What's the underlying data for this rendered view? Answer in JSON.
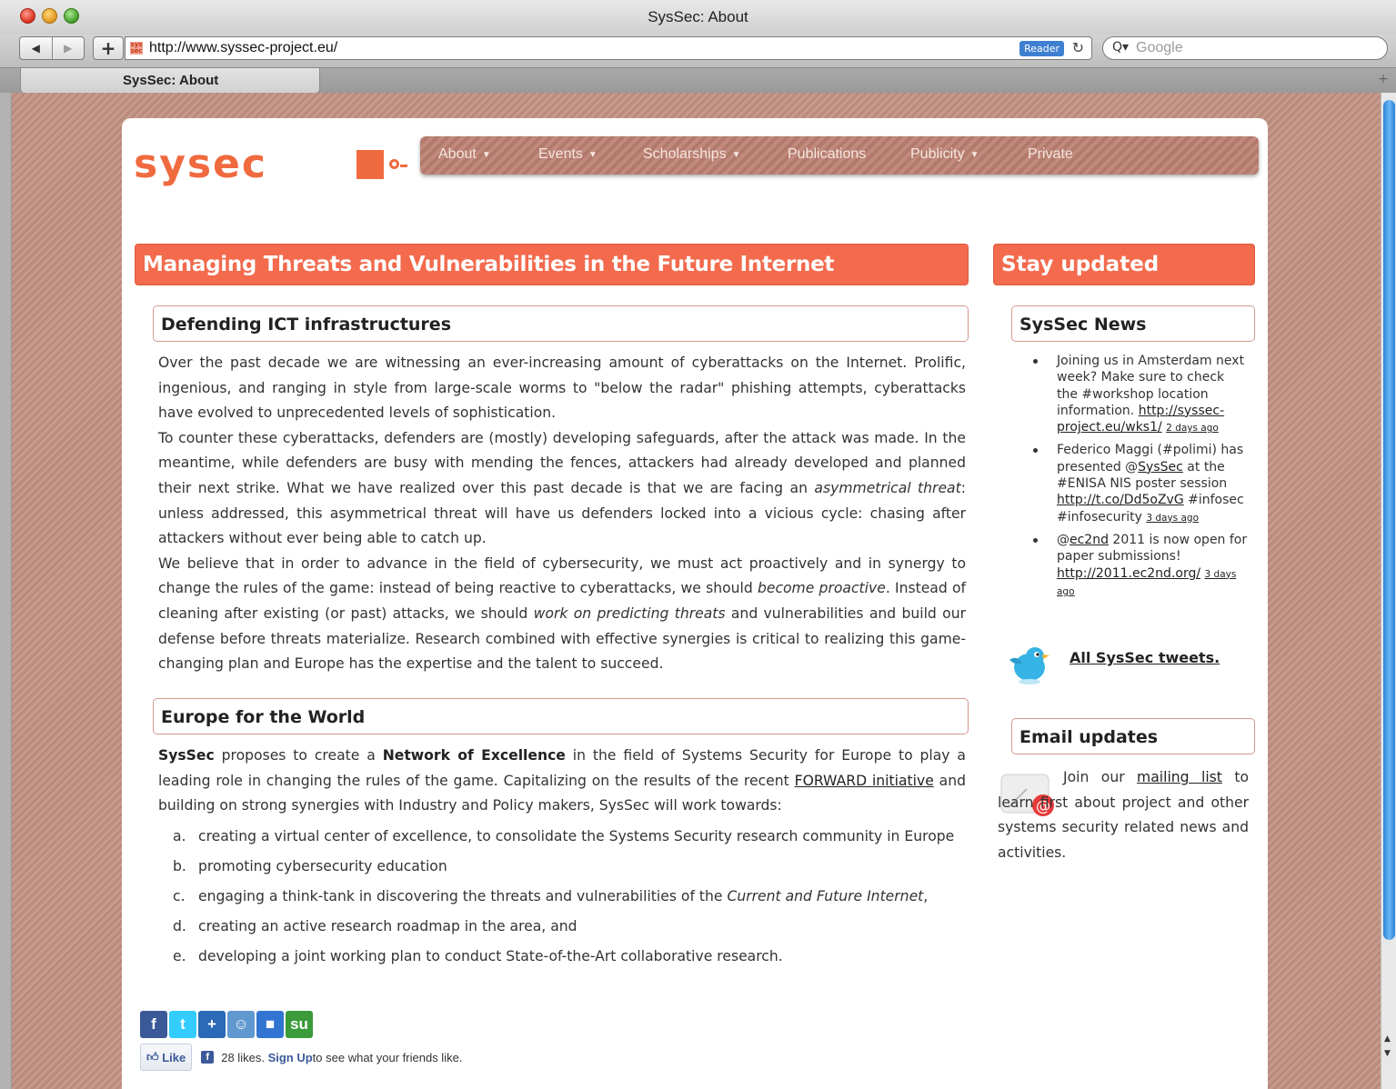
{
  "window": {
    "title": "SysSec: About"
  },
  "toolbar": {
    "back": "◀",
    "forward": "▶",
    "add": "+",
    "url": "http://www.syssec-project.eu/",
    "favicon_text": "sys sec",
    "reader": "Reader",
    "reload": "↻",
    "search_icon": "Q▾",
    "search_placeholder": "Google"
  },
  "tabs": [
    {
      "label": "SysSec: About"
    }
  ],
  "logo": {
    "text": "sysec"
  },
  "nav": [
    {
      "label": "About",
      "caret": "▼"
    },
    {
      "label": "Events",
      "caret": "▼"
    },
    {
      "label": "Scholarships",
      "caret": "▼"
    },
    {
      "label": "Publications",
      "caret": ""
    },
    {
      "label": "Publicity",
      "caret": "▼"
    },
    {
      "label": "Private",
      "caret": ""
    }
  ],
  "main": {
    "title": "Managing Threats and Vulnerabilities in the Future Internet",
    "sections": [
      {
        "heading": "Defending ICT infrastructures",
        "paragraphs": [
          [
            "Over the past decade we are witnessing an ever-increasing amount of cyberattacks on the Internet. Prolific, ingenious, and ranging in style from large-scale worms to \"below the radar\" phishing attempts, cyberattacks have evolved to unprecedented levels of sophistication."
          ],
          [
            "To counter these cyberattacks, defenders are (mostly) developing safeguards, after the attack was made. In the meantime, while defenders are busy with mending the fences, attackers had already developed and planned their next strike. What we have realized over this past decade is that we are facing an ",
            "asymmetrical threat",
            ": unless addressed, this asymmetrical threat will have us defenders locked into a vicious cycle: chasing after attackers without ever being able to catch up."
          ],
          [
            "We believe that in order to advance in the field of cybersecurity, we must act proactively and in synergy to change the rules of the game: instead of being reactive to cyberattacks, we should ",
            "become proactive",
            ". Instead of cleaning after existing (or past) attacks, we should ",
            "work on predicting threats",
            " and vulnerabilities and build our defense before threats materialize. Research combined with effective synergies is critical to realizing this game-changing plan and Europe has the expertise and the talent to succeed."
          ]
        ]
      },
      {
        "heading": "Europe for the World",
        "intro": {
          "b1": "SysSec",
          "t1": " proposes to create a ",
          "b2": "Network of Excellence",
          "t2": " in the field of Systems Security for Europe to play a leading role in changing the rules of the game. Capitalizing on the results of the recent ",
          "link": "FORWARD initiative",
          "t3": " and building on strong synergies with Industry and Policy makers, SysSec will work towards:"
        },
        "list": [
          {
            "marker": "a.",
            "text": "creating a virtual center of excellence, to consolidate the Systems Security research community in Europe"
          },
          {
            "marker": "b.",
            "text": "promoting cybersecurity education"
          },
          {
            "marker": "c.",
            "pre": "engaging a think-tank in discovering the threats and vulnerabilities of the ",
            "em": "Current and Future Internet",
            "post": ","
          },
          {
            "marker": "d.",
            "text": "creating an active research roadmap in the area, and"
          },
          {
            "marker": "e.",
            "text": "developing a joint working plan to conduct State-of-the-Art collaborative research."
          }
        ]
      }
    ]
  },
  "sidebar": {
    "title": "Stay updated",
    "news_heading": "SysSec News",
    "news": [
      {
        "t1": "Joining us in Amsterdam next week? Make sure to check the #workshop location information. ",
        "link": "http://syssec-project.eu/wks1/",
        "ago": "2 days ago"
      },
      {
        "t1": "Federico Maggi (#polimi) has presented @",
        "link1": "SysSec",
        "t2": " at the #ENISA NIS poster session ",
        "link": "http://t.co/Dd5oZvG",
        "t3": " #infosec #infosecurity ",
        "ago": "3 days ago"
      },
      {
        "t1": "@",
        "link1": "ec2nd",
        "t2": " 2011 is now open for paper submissions! ",
        "link": "http://2011.ec2nd.org/",
        "ago": "3 days ago"
      }
    ],
    "all_tweets": "All SysSec tweets.",
    "email_heading": "Email updates",
    "email": {
      "t1": "Join our ",
      "link": "mailing list",
      "t2": " to learn first about project and other systems security related news and activities."
    }
  },
  "share": {
    "buttons": [
      {
        "label": "f",
        "color": "#3b5998"
      },
      {
        "label": "t",
        "color": "#33ccff"
      },
      {
        "label": "+",
        "color": "#2a6ab6"
      },
      {
        "label": "☺",
        "color": "#5f99cf"
      },
      {
        "label": "■",
        "color": "#3274d1"
      },
      {
        "label": "su",
        "color": "#3a9b3a"
      }
    ],
    "like": "Like",
    "fb_icon": "f",
    "likes_count": "28 likes.",
    "signup": "Sign Up",
    "tail": " to see what your friends like."
  },
  "colors": {
    "accent": "#f36a4d",
    "logo": "#f06a3f",
    "background_stripes": "#c89a8c"
  }
}
